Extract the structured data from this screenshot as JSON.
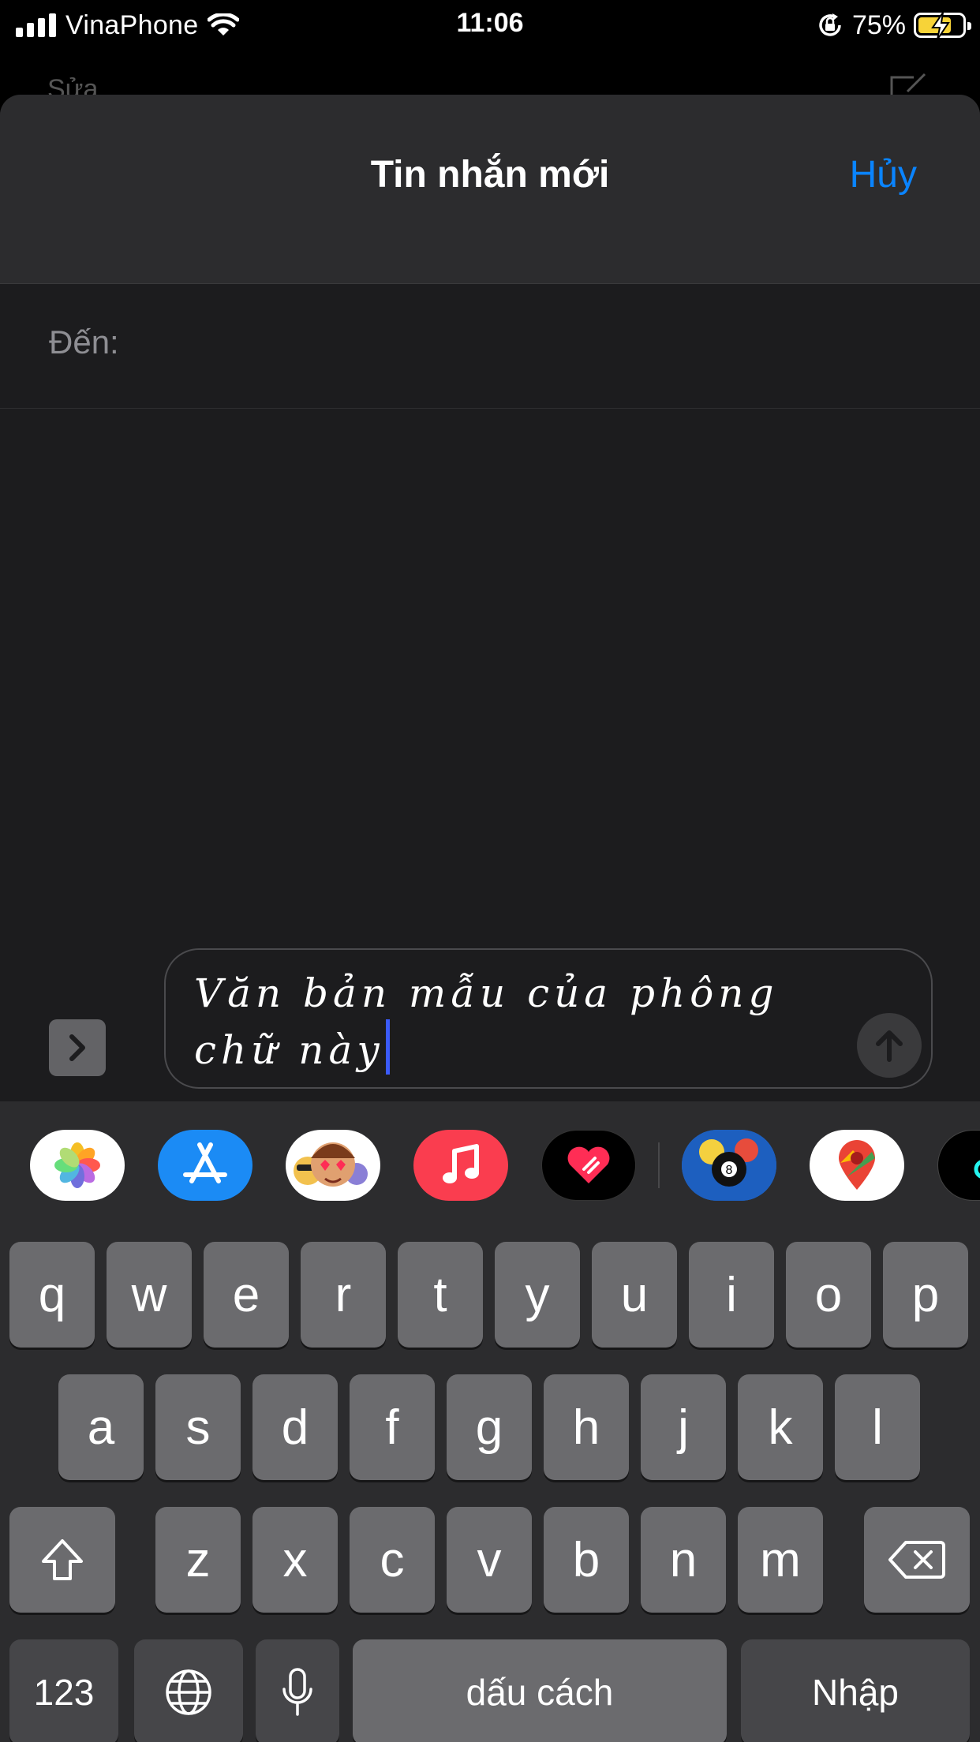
{
  "status_bar": {
    "carrier": "VinaPhone",
    "time": "11:06",
    "battery_percent": "75%",
    "battery_level": 0.75,
    "battery_color": "#f7d338"
  },
  "background_page": {
    "edit_label": "Sửa"
  },
  "sheet": {
    "title": "Tin nhắn mới",
    "cancel_label": "Hủy",
    "to_label": "Đến:"
  },
  "compose": {
    "message_text": "Văn bản mẫu của phông chữ này"
  },
  "apps": [
    "photos-icon",
    "app-store-icon",
    "memoji-icon",
    "music-icon",
    "digital-touch-icon",
    "8-ball-pool-icon",
    "google-maps-icon",
    "tiktok-icon"
  ],
  "keyboard": {
    "row1": [
      "q",
      "w",
      "e",
      "r",
      "t",
      "y",
      "u",
      "i",
      "o",
      "p"
    ],
    "row2": [
      "a",
      "s",
      "d",
      "f",
      "g",
      "h",
      "j",
      "k",
      "l"
    ],
    "row3": [
      "z",
      "x",
      "c",
      "v",
      "b",
      "n",
      "m"
    ],
    "numbers_label": "123",
    "space_label": "dấu cách",
    "return_label": "Nhập"
  },
  "colors": {
    "accent": "#0a84ff",
    "sheet_bg": "#1c1c1e",
    "key_bg": "#6b6b6e",
    "cursor": "#3b5bfb"
  }
}
